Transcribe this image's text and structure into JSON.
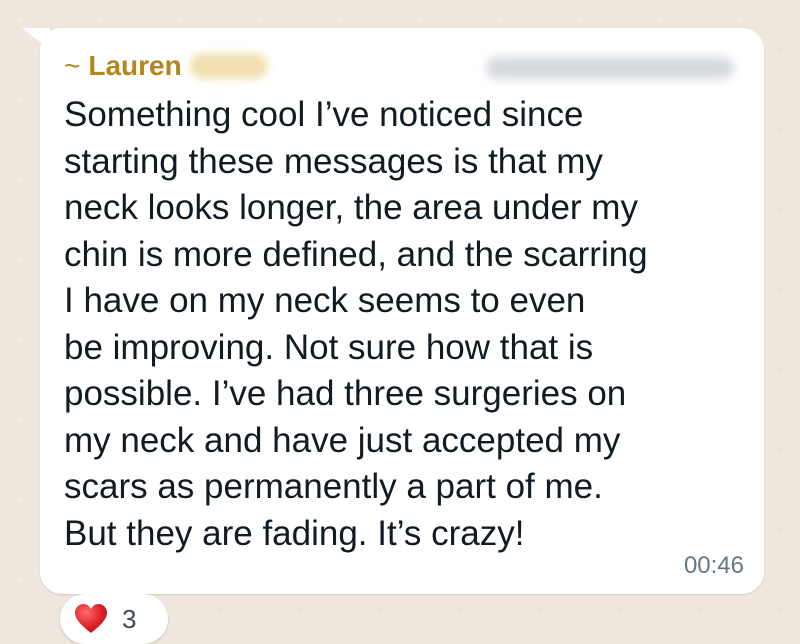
{
  "message": {
    "sender_prefix": "~",
    "sender_name": "Lauren",
    "text": "Something cool I’ve noticed since\nstarting these messages is that my\nneck looks longer, the area under my\nchin is more defined, and the scarring\nI have on my neck seems to even\nbe improving. Not sure how that is\npossible. I’ve had three surgeries on\nmy neck and have just accepted my\nscars as permanently a part of me.\nBut they are fading. It’s crazy!",
    "time": "00:46"
  },
  "reaction": {
    "icon": "heart-icon",
    "count": "3",
    "color": "#e0262b"
  },
  "colors": {
    "sender": "#b1861e",
    "bubble": "#ffffff",
    "background": "#efe7de",
    "text": "#111b21",
    "timestamp": "#667781"
  }
}
